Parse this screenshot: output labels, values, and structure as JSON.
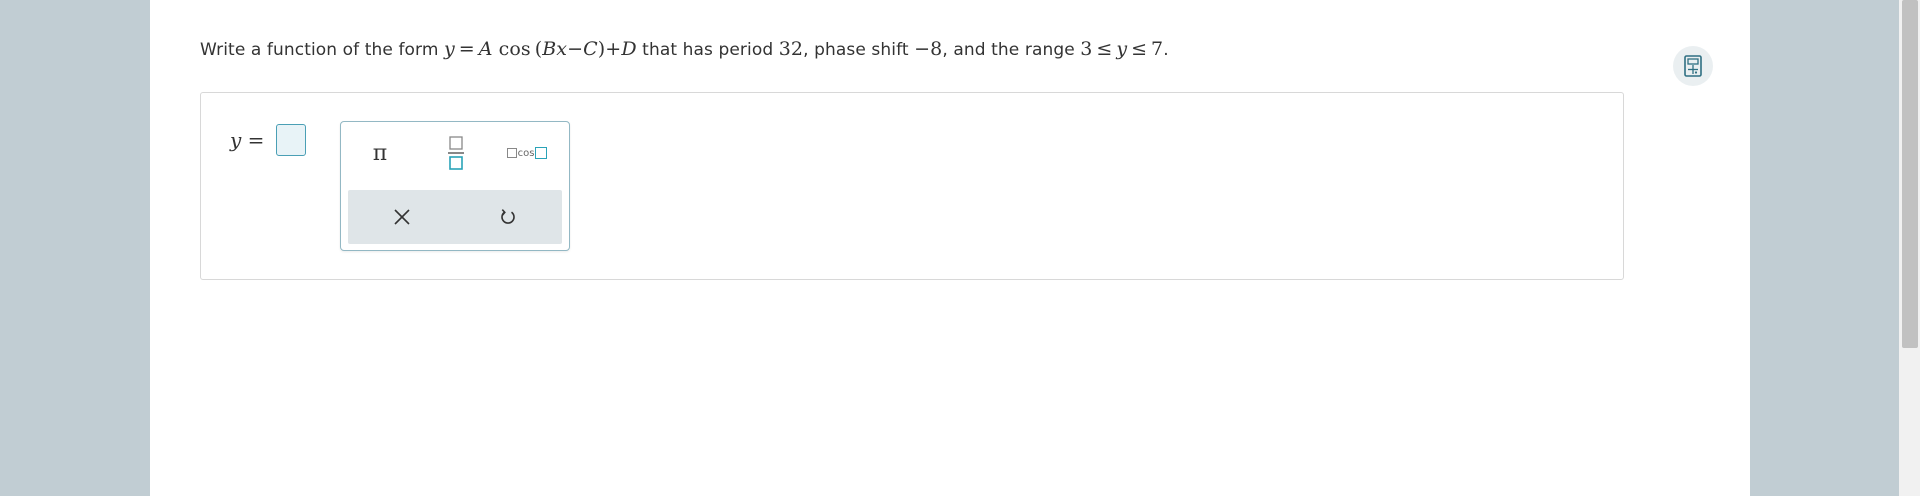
{
  "question": {
    "prefix": "Write a function of the form ",
    "form": {
      "y": "y",
      "eq": "=",
      "A": "A",
      "cos": "cos",
      "lp": "(",
      "B": "B",
      "x": "x",
      "minus": "−",
      "C": "C",
      "rp": ")",
      "plus": "+",
      "D": "D"
    },
    "mid1": " that has period ",
    "period": "32",
    "mid2": ", phase shift ",
    "shift": "−8",
    "mid3": ", and the range ",
    "range": {
      "low": "3",
      "le1": "≤",
      "y": "y",
      "le2": "≤",
      "high": "7"
    },
    "end": "."
  },
  "answer": {
    "y_var": "y",
    "equals": "=",
    "value": ""
  },
  "palette": {
    "pi_label": "π",
    "cos_label": "cos",
    "clear_icon": "close-icon",
    "undo_icon": "undo-icon"
  },
  "toolbar": {
    "calculator_icon": "calculator-icon"
  },
  "colors": {
    "page_bg": "#c1cdd3",
    "accent": "#2aa3b8",
    "input_border": "#4a9fb5",
    "palette_bottom": "#dfe5e8"
  }
}
